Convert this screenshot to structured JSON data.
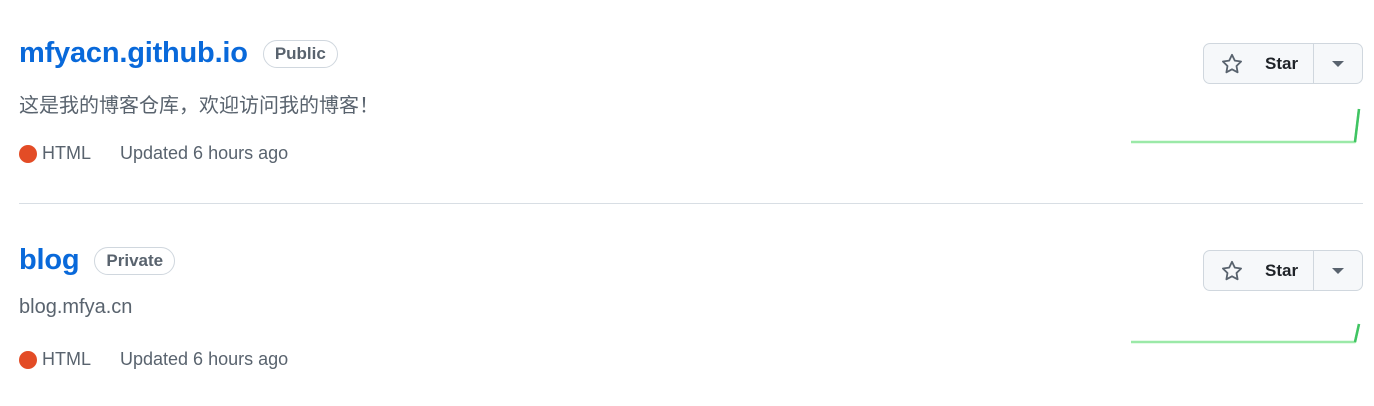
{
  "repos": [
    {
      "name": "mfyacn.github.io",
      "visibility": "Public",
      "description": "这是我的博客仓库，欢迎访问我的博客！",
      "language": "HTML",
      "language_color": "#e34c26",
      "updated": "Updated 6 hours ago",
      "star_label": "Star"
    },
    {
      "name": "blog",
      "visibility": "Private",
      "description": "blog.mfya.cn",
      "language": "HTML",
      "language_color": "#e34c26",
      "updated": "Updated 6 hours ago",
      "star_label": "Star"
    }
  ],
  "icons": {
    "star": "star-icon",
    "dropdown": "triangle-down-icon"
  },
  "colors": {
    "link": "#0969da",
    "sparkline": "#9be9a8",
    "sparkline_end": "#40c463"
  }
}
